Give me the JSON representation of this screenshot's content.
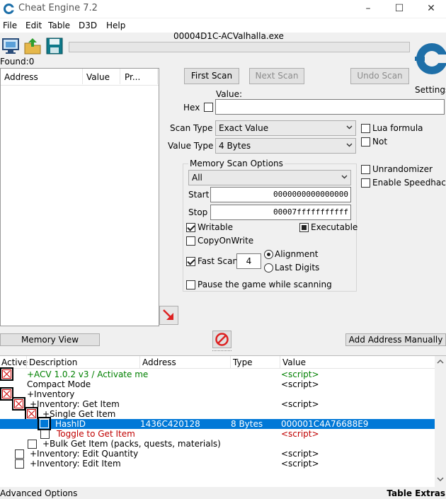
{
  "app": {
    "title": "Cheat Engine 7.2",
    "process": "00004D1C-ACValhalla.exe",
    "found": "Found:0",
    "settings_label": "Settings"
  },
  "menu": [
    "File",
    "Edit",
    "Table",
    "D3D",
    "Help"
  ],
  "colors": {
    "selected_row": "#0078d7",
    "green": "#008000",
    "red": "#c00000"
  },
  "results_headers": [
    "Address",
    "Value",
    "Pr..."
  ],
  "scan": {
    "first_scan": "First Scan",
    "next_scan": "Next Scan",
    "undo_scan": "Undo Scan",
    "value_label": "Value:",
    "hex_label": "Hex",
    "scan_type_label": "Scan Type",
    "scan_type_value": "Exact Value",
    "value_type_label": "Value Type",
    "value_type_value": "4 Bytes",
    "lua_formula": "Lua formula",
    "not": "Not",
    "mem_title": "Memory Scan Options",
    "mem_region": "All",
    "start_label": "Start",
    "start_value": "0000000000000000",
    "stop_label": "Stop",
    "stop_value": "00007fffffffffff",
    "writable": "Writable",
    "executable": "Executable",
    "copyonwrite": "CopyOnWrite",
    "fast_scan": "Fast Scan",
    "fast_scan_value": "4",
    "alignment": "Alignment",
    "last_digits": "Last Digits",
    "pause": "Pause the game while scanning",
    "unrandomizer": "Unrandomizer",
    "speedhack": "Enable Speedhack"
  },
  "mid": {
    "memory_view": "Memory View",
    "add_address": "Add Address Manually"
  },
  "table": {
    "headers": [
      "Active",
      "Description",
      "Address",
      "Type",
      "Value"
    ],
    "rows": [
      {
        "desc": "+ACV 1.0.2 v3 / Activate me",
        "address": "",
        "type": "",
        "value": "<script>"
      },
      {
        "desc": "Compact Mode",
        "address": "",
        "type": "",
        "value": "<script>"
      },
      {
        "desc": "+Inventory",
        "address": "",
        "type": "",
        "value": ""
      },
      {
        "desc": "+Inventory: Get Item",
        "address": "",
        "type": "",
        "value": "<script>"
      },
      {
        "desc": "+Single Get Item",
        "address": "",
        "type": "",
        "value": ""
      },
      {
        "desc": "HashID",
        "address": "1436C420128",
        "type": "8 Bytes",
        "value": "000001C4A76688E9"
      },
      {
        "desc": "Toggle to Get Item",
        "address": "",
        "type": "",
        "value": "<script>"
      },
      {
        "desc": "+Bulk Get Item (packs, quests, materials)",
        "address": "",
        "type": "",
        "value": ""
      },
      {
        "desc": "+Inventory: Edit Quantity",
        "address": "",
        "type": "",
        "value": "<script>"
      },
      {
        "desc": "+Inventory: Edit Item",
        "address": "",
        "type": "",
        "value": "<script>"
      }
    ]
  },
  "footer": {
    "advanced": "Advanced Options",
    "extras": "Table Extras"
  }
}
